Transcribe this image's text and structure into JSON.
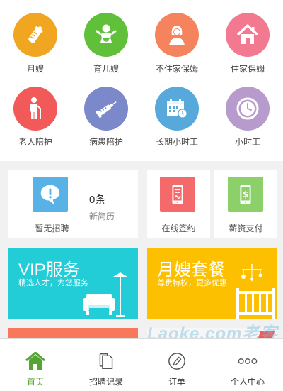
{
  "services": [
    {
      "label": "月嫂",
      "icon": "baby-bottle-icon",
      "color": "#f0a620"
    },
    {
      "label": "育儿嫂",
      "icon": "baby-icon",
      "color": "#61c03a"
    },
    {
      "label": "不住家保姆",
      "icon": "woman-icon",
      "color": "#f5845e"
    },
    {
      "label": "住家保姆",
      "icon": "house-icon",
      "color": "#f2798f"
    },
    {
      "label": "老人陪护",
      "icon": "elderly-icon",
      "color": "#f25a5a"
    },
    {
      "label": "病患陪护",
      "icon": "syringe-icon",
      "color": "#7b88c9"
    },
    {
      "label": "长期小时工",
      "icon": "calendar-icon",
      "color": "#57a9dc"
    },
    {
      "label": "小时工",
      "icon": "clock-icon",
      "color": "#b79bcc"
    }
  ],
  "recruit": {
    "caption": "暂无招聘",
    "count": "0条",
    "resume": "新简历",
    "icon": "alert-bubble-icon",
    "color": "#58b2e5"
  },
  "sign": {
    "caption": "在线签约",
    "icon": "phone-sign-icon",
    "color": "#f46a6a"
  },
  "pay": {
    "caption": "薪资支付",
    "icon": "money-phone-icon",
    "color": "#8bd068"
  },
  "banners": [
    {
      "title": "VIP服务",
      "subtitle": "精选人才，为您服务",
      "color": "#23cdd8"
    },
    {
      "title": "月嫂套餐",
      "subtitle": "尊贵特权，更多优惠",
      "color": "#fcc000"
    }
  ],
  "watermark": "Laoke.com老客",
  "tabs": [
    {
      "label": "首页",
      "icon": "home-icon",
      "active": true
    },
    {
      "label": "招聘记录",
      "icon": "document-icon",
      "active": false
    },
    {
      "label": "订单",
      "icon": "pen-circle-icon",
      "active": false
    },
    {
      "label": "个人中心",
      "icon": "more-dots-icon",
      "active": false
    }
  ],
  "colors": {
    "active_tab": "#55a532"
  }
}
